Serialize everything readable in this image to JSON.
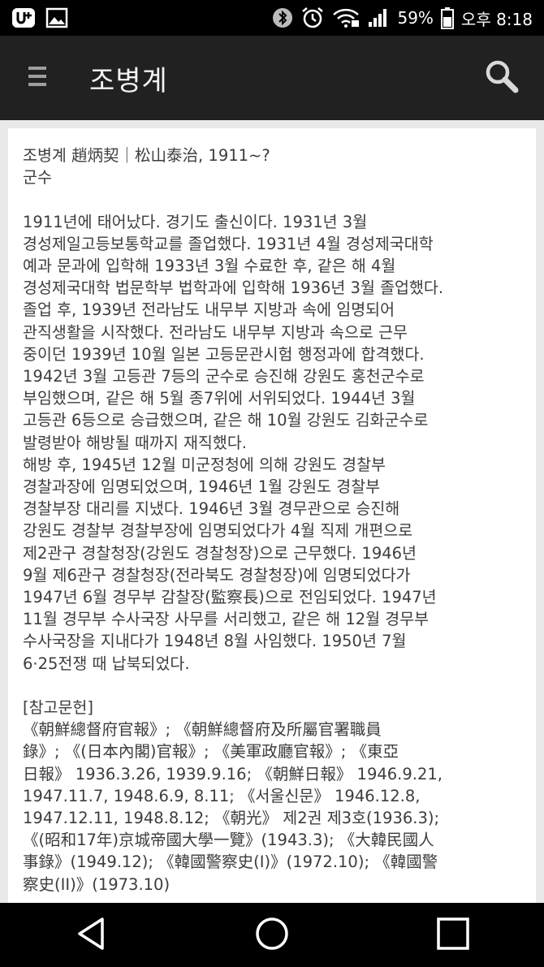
{
  "status_bar": {
    "battery_percent": "59%",
    "time": "오후 8:18"
  },
  "app_bar": {
    "title": "조병계"
  },
  "article": {
    "heading_line1": "조병계 趙炳契｜松山泰治, 1911~?",
    "heading_line2": "군수",
    "bio_lines": [
      "1911년에 태어났다. 경기도 출신이다. 1931년 3월",
      "경성제일고등보통학교를 졸업했다. 1931년 4월 경성제국대학",
      "예과 문과에 입학해 1933년 3월 수료한 후, 같은 해 4월",
      "경성제국대학 법문학부 법학과에 입학해 1936년 3월 졸업했다.",
      "졸업 후, 1939년 전라남도 내무부 지방과 속에 임명되어",
      "관직생활을 시작했다. 전라남도 내무부 지방과 속으로 근무",
      "중이던 1939년 10월 일본 고등문관시험 행정과에 합격했다.",
      "1942년 3월 고등관 7등의 군수로 승진해 강원도 홍천군수로",
      "부임했으며, 같은 해 5월 종7위에 서위되었다. 1944년 3월",
      "고등관 6등으로 승급했으며, 같은 해 10월 강원도 김화군수로",
      "발령받아 해방될 때까지 재직했다.",
      "해방 후, 1945년 12월 미군정청에 의해 강원도 경찰부",
      "경찰과장에 임명되었으며, 1946년 1월 강원도 경찰부",
      "경찰부장 대리를 지냈다. 1946년 3월 경무관으로 승진해",
      "강원도 경찰부 경찰부장에 임명되었다가 4월 직제 개편으로",
      "제2관구 경찰청장(강원도 경찰청장)으로 근무했다. 1946년",
      "9월 제6관구 경찰청장(전라북도 경찰청장)에 임명되었다가",
      "1947년 6월 경무부 감찰장(監察長)으로 전임되었다. 1947년",
      "11월 경무부 수사국장 사무를 서리했고, 같은 해 12월 경무부",
      "수사국장을 지내다가 1948년 8월 사임했다. 1950년 7월",
      "6·25전쟁 때 납북되었다."
    ],
    "references_heading": "[참고문헌]",
    "reference_lines": [
      "《朝鮮總督府官報》; 《朝鮮總督府及所屬官署職員",
      "錄》; 《(日本內閣)官報》; 《美軍政廳官報》; 《東亞",
      "日報》 1936.3.26, 1939.9.16; 《朝鮮日報》 1946.9.21,",
      "1947.11.7, 1948.6.9, 8.11; 《서울신문》 1946.12.8,",
      "1947.12.11, 1948.8.12; 《朝光》 제2권 제3호(1936.3);",
      "《(昭和17年)京城帝國大學一覽》(1943.3); 《大韓民國人",
      "事錄》(1949.12); 《韓國警察史(I)》(1972.10); 《韓國警",
      "察史(II)》(1973.10)"
    ]
  },
  "icons": {
    "status_left": [
      "u-plus-icon",
      "gallery-icon"
    ],
    "status_right": [
      "bluetooth-icon",
      "alarm-icon",
      "wifi-icon",
      "signal-icon",
      "battery-icon"
    ],
    "nav": [
      "back-icon",
      "home-icon",
      "recents-icon"
    ]
  }
}
